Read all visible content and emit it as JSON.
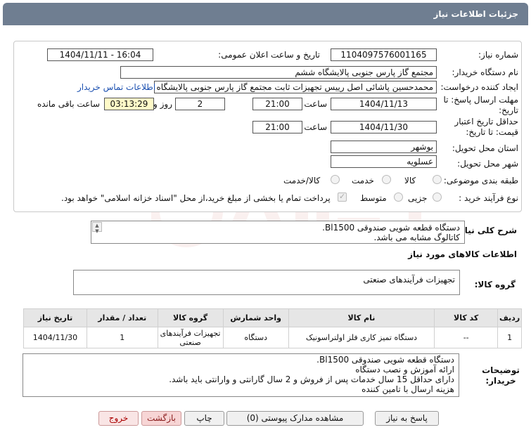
{
  "header": {
    "title": "جزئیات اطلاعات نیاز"
  },
  "form": {
    "need_number_label": "شماره نیاز:",
    "need_number": "1104097576001165",
    "announce_label": "تاریخ و ساعت اعلان عمومی:",
    "announce_value": "1404/11/11 - 16:04",
    "buyer_label": "نام دستگاه خریدار:",
    "buyer_value": "مجتمع گاز پارس جنوبی  پالایشگاه ششم",
    "creator_label": "ایجاد کننده درخواست:",
    "creator_value": "محمدحسین پاشائی اصل رییس تجهیزات ثابت مجتمع گاز پارس جنوبی  پالایشگاه",
    "contact_link": "اطلاعات تماس خریدار",
    "deadline_label": "مهلت ارسال پاسخ: تا تاریخ:",
    "deadline_date": "1404/11/13",
    "time_label": "ساعت",
    "deadline_time": "21:00",
    "days_value": "2",
    "days_label": "روز و",
    "remaining_time": "03:13:29",
    "remaining_label": "ساعت باقی مانده",
    "validity_label": "حداقل تاریخ اعتبار قیمت: تا تاریخ:",
    "validity_date": "1404/11/30",
    "validity_time": "21:00",
    "province_label": "استان محل تحویل:",
    "province_value": "بوشهر",
    "city_label": "شهر محل تحویل:",
    "city_value": "عسلویه",
    "category_label": "طبقه بندی موضوعی:",
    "category_options": [
      "کالا",
      "خدمت",
      "کالا/خدمت"
    ],
    "process_label": "نوع فرآیند خرید :",
    "process_options": [
      "جزیی",
      "متوسط"
    ],
    "payment_note": "پرداخت تمام یا بخشی از مبلغ خرید،از محل \"اسناد خزانه اسلامی\" خواهد بود."
  },
  "summary": {
    "label": "شرح کلی نیاز:",
    "line1": "دستگاه قطعه شویی صندوقی Bl1500.",
    "line2": "کاتالوگ مشابه می باشد."
  },
  "goods": {
    "section_title": "اطلاعات کالاهای مورد نیاز",
    "group_label": "گروه کالا:",
    "group_value": "تجهیزات فرآیندهای صنعتی"
  },
  "table": {
    "headers": [
      "ردیف",
      "کد کالا",
      "نام کالا",
      "واحد شمارش",
      "گروه کالا",
      "تعداد / مقدار",
      "تاریخ نیاز"
    ],
    "rows": [
      [
        "1",
        "--",
        "دستگاه تمیز کاری فلز اولتراسونیک",
        "دستگاه",
        "تجهیزات فرآیندهای صنعتی",
        "1",
        "1404/11/30"
      ]
    ]
  },
  "notes": {
    "label": "توضیحات خریدار:",
    "lines": [
      "دستگاه قطعه شویی صندوقی Bl1500.",
      "ارائه آموزش و نصب دستگاه",
      "دارای حداقل 15 سال خدمات پس از فروش و 2 سال  گارانتی و وارانتی باید باشد.",
      "هزینه ارسال با تامین کننده"
    ]
  },
  "buttons": {
    "reply": "پاسخ به نیاز",
    "docs": "مشاهده مدارک پیوستی (0)",
    "print": "چاپ",
    "back": "بازگشت",
    "exit": "خروج"
  },
  "colors": {
    "header_bg": "#6f7e91",
    "link": "#1a4fb0",
    "highlight": "#fffac8"
  }
}
